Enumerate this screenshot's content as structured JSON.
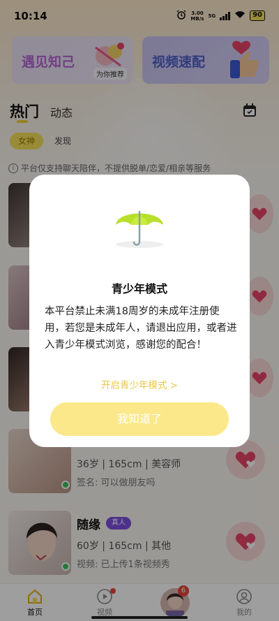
{
  "status_bar": {
    "time": "10:14",
    "net_speed": "3.00",
    "net_unit": "MB/s",
    "signal_label": "5G",
    "battery": "90"
  },
  "banners": {
    "left": {
      "title": "遇见知己",
      "subtitle": "为你推荐"
    },
    "right": {
      "title": "视频速配"
    }
  },
  "tabs": {
    "hot": "热门",
    "dynamic": "动态"
  },
  "chips": {
    "goddess": "女神",
    "discover": "发现"
  },
  "notice": {
    "icon": "i",
    "text": "平台仅支持聊天陪伴，不提供脱单/恋爱/相亲等服务"
  },
  "users": [
    {
      "name": "",
      "badge": "",
      "info": "",
      "sign": ""
    },
    {
      "name": "",
      "badge": "",
      "info": "",
      "sign": ""
    },
    {
      "name": "",
      "badge": "",
      "info": "",
      "sign": ""
    },
    {
      "name": "",
      "badge": "",
      "info": "36岁 | 165cm | 美容师",
      "sign": "签名: 可以做朋友吗"
    },
    {
      "name": "随缘",
      "badge": "真人",
      "info": "60岁 | 165cm | 其他",
      "sign": "视频: 已上传1条视频秀"
    }
  ],
  "bottom_nav": {
    "home": "首页",
    "video": "视频",
    "badge_count": "6",
    "me": "我的"
  },
  "modal": {
    "title": "青少年模式",
    "body": "本平台禁止未满18周岁的未成年注册使用，若您是未成年人，请退出应用，或者进入青少年模式浏览，感谢您的配合！",
    "link": "开启青少年模式 >",
    "button": "我知道了"
  },
  "colors": {
    "accent_yellow": "#f7e35b",
    "badge_purple": "#7c4fe0",
    "heart_pink": "#e8456a",
    "modal_link": "#e9c84a"
  }
}
